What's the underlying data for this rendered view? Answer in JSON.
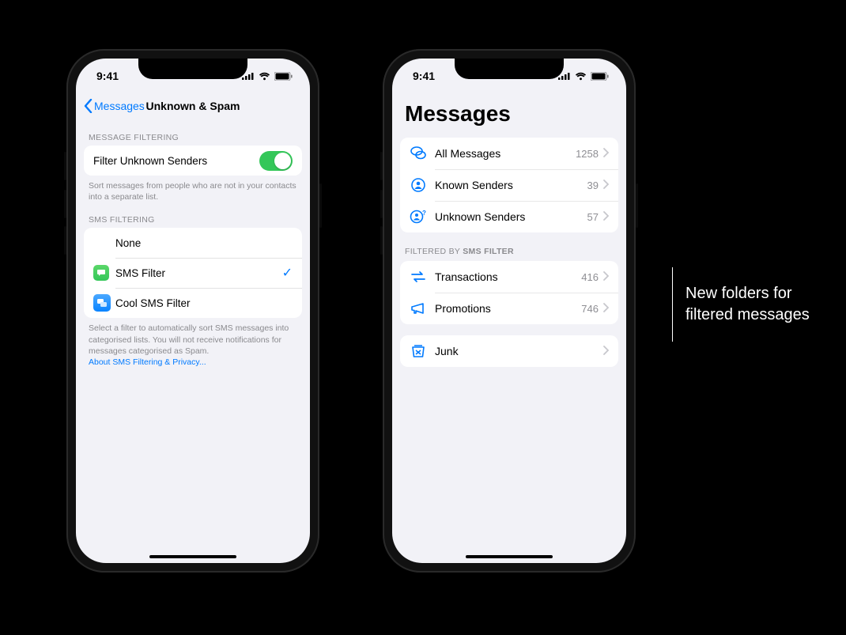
{
  "statusbar": {
    "time": "9:41"
  },
  "settings": {
    "back_label": "Messages",
    "title": "Unknown & Spam",
    "section1_header": "MESSAGE FILTERING",
    "filter_unknown_label": "Filter Unknown Senders",
    "filter_unknown_footer": "Sort messages from people who are not in your contacts into a separate list.",
    "section2_header": "SMS FILTERING",
    "options": {
      "none": "None",
      "sms_filter": "SMS Filter",
      "cool_sms_filter": "Cool SMS Filter"
    },
    "sms_footer": "Select a filter to automatically sort SMS messages into categorised lists. You will not receive notifications for messages categorised as Spam.",
    "sms_footer_link": "About SMS Filtering & Privacy..."
  },
  "messages": {
    "title": "Messages",
    "folders": [
      {
        "label": "All Messages",
        "count": "1258"
      },
      {
        "label": "Known Senders",
        "count": "39"
      },
      {
        "label": "Unknown Senders",
        "count": "57"
      }
    ],
    "filtered_header_prefix": "FILTERED BY ",
    "filtered_header_app": "SMS FILTER",
    "filtered": [
      {
        "label": "Transactions",
        "count": "416"
      },
      {
        "label": "Promotions",
        "count": "746"
      }
    ],
    "junk_label": "Junk"
  },
  "annotation": "New folders for filtered messages"
}
